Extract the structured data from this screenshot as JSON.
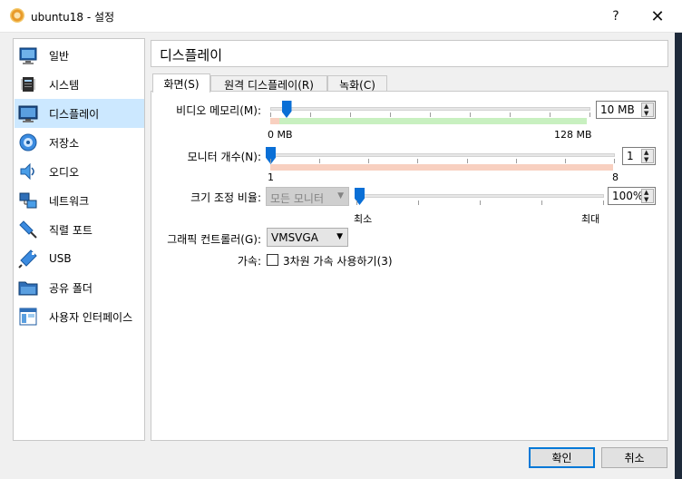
{
  "window": {
    "title": "ubuntu18 - 설정",
    "help_label": "?",
    "close_label": "✕"
  },
  "sidebar": {
    "items": [
      {
        "label": "일반",
        "icon": "general-icon"
      },
      {
        "label": "시스템",
        "icon": "system-icon"
      },
      {
        "label": "디스플레이",
        "icon": "display-icon",
        "selected": true
      },
      {
        "label": "저장소",
        "icon": "storage-icon"
      },
      {
        "label": "오디오",
        "icon": "audio-icon"
      },
      {
        "label": "네트워크",
        "icon": "network-icon"
      },
      {
        "label": "직렬 포트",
        "icon": "serial-port-icon"
      },
      {
        "label": "USB",
        "icon": "usb-icon"
      },
      {
        "label": "공유 폴더",
        "icon": "shared-folder-icon"
      },
      {
        "label": "사용자 인터페이스",
        "icon": "user-interface-icon"
      }
    ]
  },
  "header": {
    "title": "디스플레이"
  },
  "tabs": [
    {
      "label": "화면(S)",
      "active": true
    },
    {
      "label": "원격 디스플레이(R)",
      "active": false
    },
    {
      "label": "녹화(C)",
      "active": false
    }
  ],
  "screen": {
    "video_memory": {
      "label": "비디오 메모리(M):",
      "value": "10 MB",
      "min_label": "0 MB",
      "max_label": "128 MB",
      "min": 0,
      "max": 128,
      "current": 10
    },
    "monitor_count": {
      "label": "모니터 개수(N):",
      "value": "1",
      "min_label": "1",
      "max_label": "8",
      "min": 1,
      "max": 8,
      "current": 1
    },
    "scale_factor": {
      "label": "크기 조정 비율:",
      "combo_value": "모든 모니터",
      "value": "100%",
      "min_label": "최소",
      "max_label": "최대",
      "fraction": 0
    },
    "graphics_controller": {
      "label": "그래픽 컨트롤러(G):",
      "value": "VMSVGA"
    },
    "acceleration": {
      "label": "가속:",
      "checkbox_label": "3차원 가속 사용하기(3)",
      "checked": false
    }
  },
  "buttons": {
    "ok": "확인",
    "cancel": "취소"
  },
  "colors": {
    "selection": "#cce8ff",
    "accent": "#0078d7",
    "slider": "#0a6fd6",
    "range_ok": "#c8f0c0",
    "range_warn": "#f8d0c0"
  }
}
